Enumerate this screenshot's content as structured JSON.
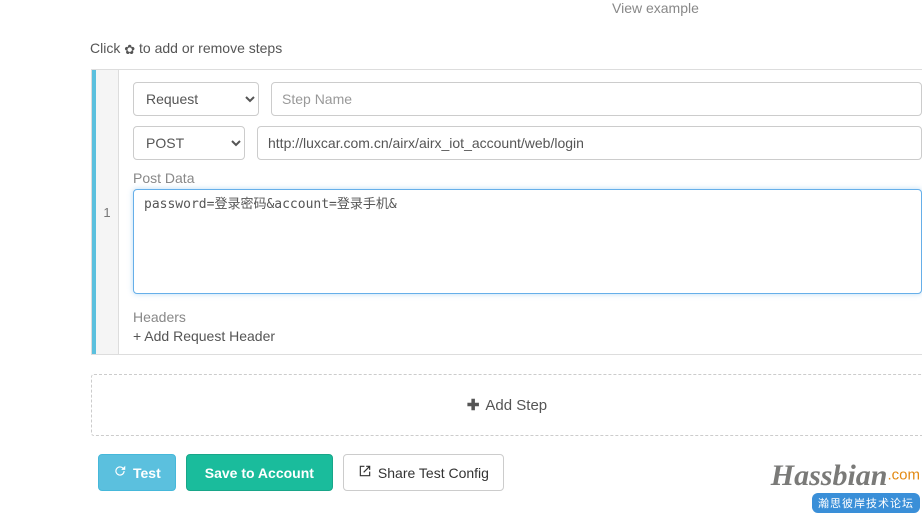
{
  "top_link": "View example",
  "instructions": {
    "pre": "Click ",
    "post": " to add or remove steps"
  },
  "step": {
    "number": "1",
    "type_options": [
      "Request"
    ],
    "type_value": "Request",
    "name_placeholder": "Step Name",
    "name_value": "",
    "method_options": [
      "POST"
    ],
    "method_value": "POST",
    "url_value": "http://luxcar.com.cn/airx/airx_iot_account/web/login",
    "post_data_label": "Post Data",
    "post_data_value": "password=登录密码&account=登录手机&",
    "headers_label": "Headers",
    "add_header_label": "+ Add Request Header"
  },
  "add_step_label": "Add Step",
  "buttons": {
    "test": "Test",
    "save": "Save to Account",
    "share": "Share Test Config"
  },
  "watermark": {
    "main": "Hassbian",
    "tld": ".com",
    "sub": "瀚思彼岸技术论坛"
  }
}
